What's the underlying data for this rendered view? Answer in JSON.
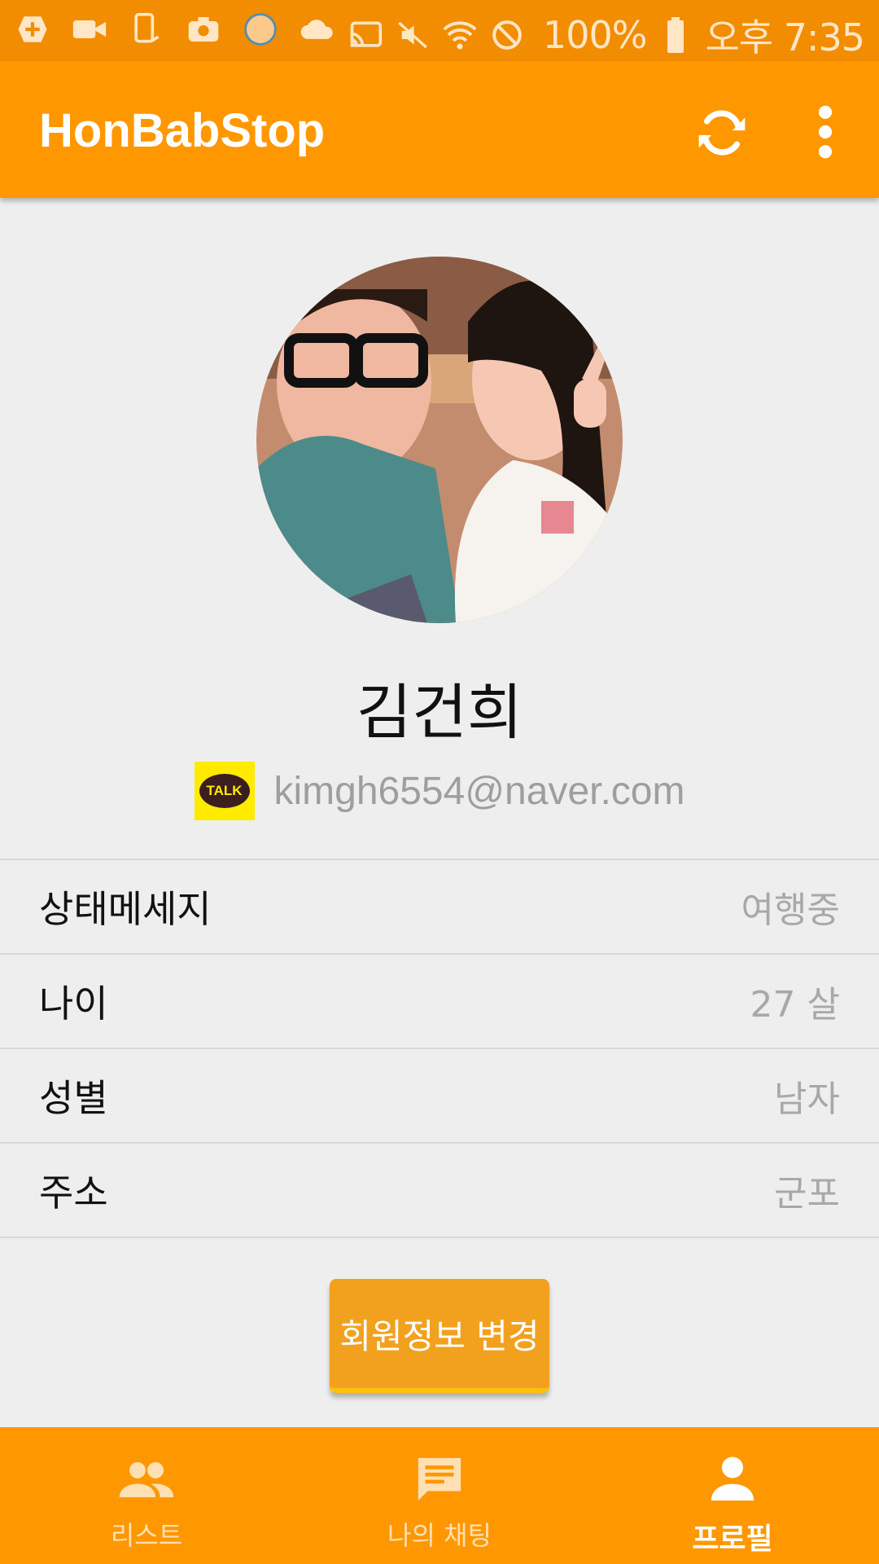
{
  "status_bar": {
    "battery": "100%",
    "time": "오후 7:35",
    "icons": [
      "add-box-icon",
      "video-camera-icon",
      "phone-rotate-icon",
      "camera-icon",
      "circle-app-icon",
      "cloud-icon",
      "cast-icon",
      "mute-icon",
      "wifi-icon",
      "block-icon",
      "battery-icon"
    ]
  },
  "app_bar": {
    "title": "HonBabStop",
    "actions": [
      "refresh-icon",
      "more-vert-icon"
    ]
  },
  "profile": {
    "name": "김건희",
    "login_badge": "TALK",
    "email": "kimgh6554@naver.com"
  },
  "info_rows": [
    {
      "label": "상태메세지",
      "value": "여행중"
    },
    {
      "label": "나이",
      "value": "27 살"
    },
    {
      "label": "성별",
      "value": "남자"
    },
    {
      "label": "주소",
      "value": "군포"
    }
  ],
  "edit_button": {
    "label": "회원정보 변경"
  },
  "bottom_nav": [
    {
      "label": "리스트",
      "icon": "people-icon",
      "active": false
    },
    {
      "label": "나의 채팅",
      "icon": "chat-icon",
      "active": false
    },
    {
      "label": "프로필",
      "icon": "person-icon",
      "active": true
    }
  ],
  "colors": {
    "primary": "#ff9700",
    "status_bar": "#f28c00",
    "button": "#f2a11f",
    "kakao_yellow": "#ffea00"
  }
}
